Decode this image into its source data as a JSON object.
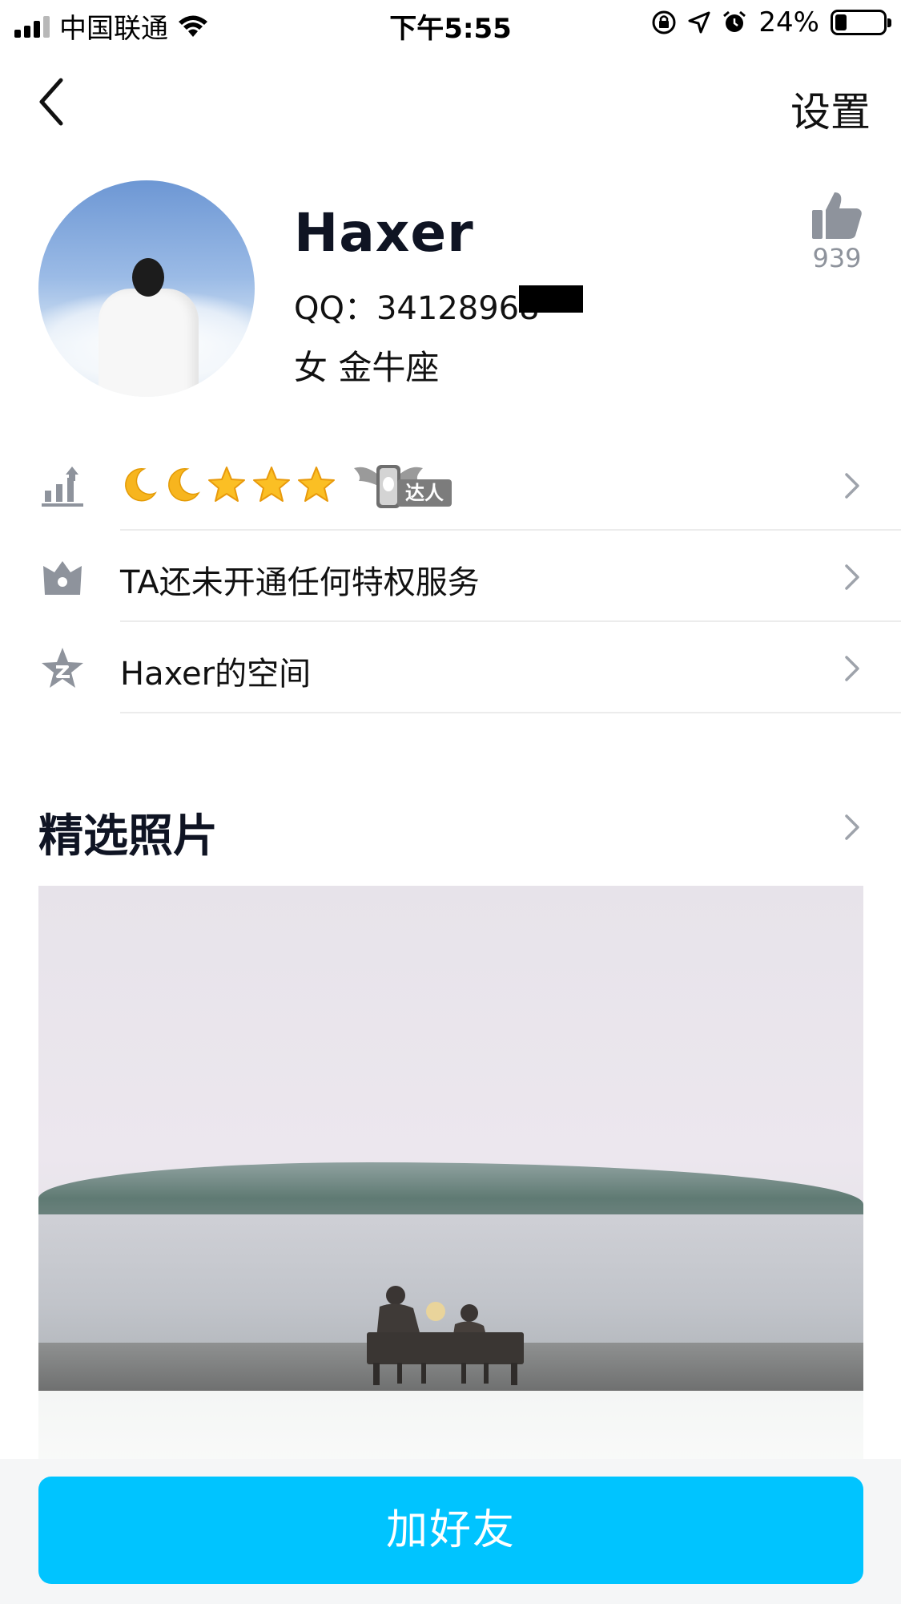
{
  "status_bar": {
    "carrier": "中国联通",
    "time": "下午5:55",
    "battery_percent": "24%",
    "battery_level": 0.24
  },
  "nav": {
    "settings_label": "设置"
  },
  "profile": {
    "name": "Haxer",
    "qq": "QQ：34128968",
    "gender_zodiac": "女  金牛座",
    "likes": "939"
  },
  "rows": [
    {
      "label": "",
      "badge": "达人"
    },
    {
      "label": "TA还未开通任何特权服务"
    },
    {
      "label": "Haxer的空间"
    }
  ],
  "photos": {
    "title": "精选照片"
  },
  "bottom": {
    "add_friend_label": "加好友"
  },
  "colors": {
    "accent": "#00c4ff",
    "icon_gray": "#8e939c",
    "title": "#0f1423"
  }
}
